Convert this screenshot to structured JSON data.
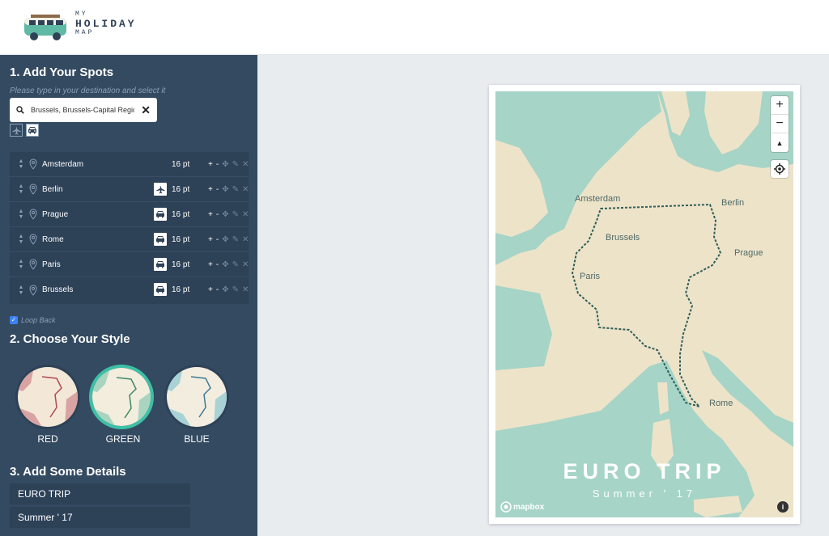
{
  "logo": {
    "line1": "MY",
    "line2": "HOLIDAY",
    "line3": "MAP"
  },
  "sections": {
    "spots_title": "1. Add Your Spots",
    "style_title": "2. Choose Your Style",
    "details_title": "3. Add Some Details"
  },
  "search": {
    "hint": "Please type in your destination and select it",
    "value": "Brussels, Brussels-Capital Region"
  },
  "spots": [
    {
      "name": "Amsterdam",
      "mode": "none",
      "size": "16 pt"
    },
    {
      "name": "Berlin",
      "mode": "plane",
      "size": "16 pt"
    },
    {
      "name": "Prague",
      "mode": "car",
      "size": "16 pt"
    },
    {
      "name": "Rome",
      "mode": "car",
      "size": "16 pt"
    },
    {
      "name": "Paris",
      "mode": "car",
      "size": "16 pt"
    },
    {
      "name": "Brussels",
      "mode": "car",
      "size": "16 pt"
    }
  ],
  "controls": {
    "plus": "+",
    "minus": "-"
  },
  "loop_back": {
    "label": "Loop Back",
    "checked": true
  },
  "styles": [
    {
      "label": "RED",
      "color": "#d9a3a3",
      "selected": false
    },
    {
      "label": "GREEN",
      "color": "#a9d4c0",
      "selected": true
    },
    {
      "label": "BLUE",
      "color": "#a8d2d6",
      "selected": false
    }
  ],
  "details": {
    "title": "EURO TRIP",
    "subtitle": "Summer ' 17"
  },
  "map": {
    "cities": {
      "amsterdam": "Amsterdam",
      "berlin": "Berlin",
      "brussels": "Brussels",
      "prague": "Prague",
      "paris": "Paris",
      "rome": "Rome"
    },
    "zoom_in": "+",
    "zoom_out": "−",
    "compass": "▲",
    "attribution": "mapbox",
    "info": "i",
    "water_color": "#a6d4c6",
    "land_color": "#ede3c9",
    "route_color": "#2f5f5a"
  }
}
